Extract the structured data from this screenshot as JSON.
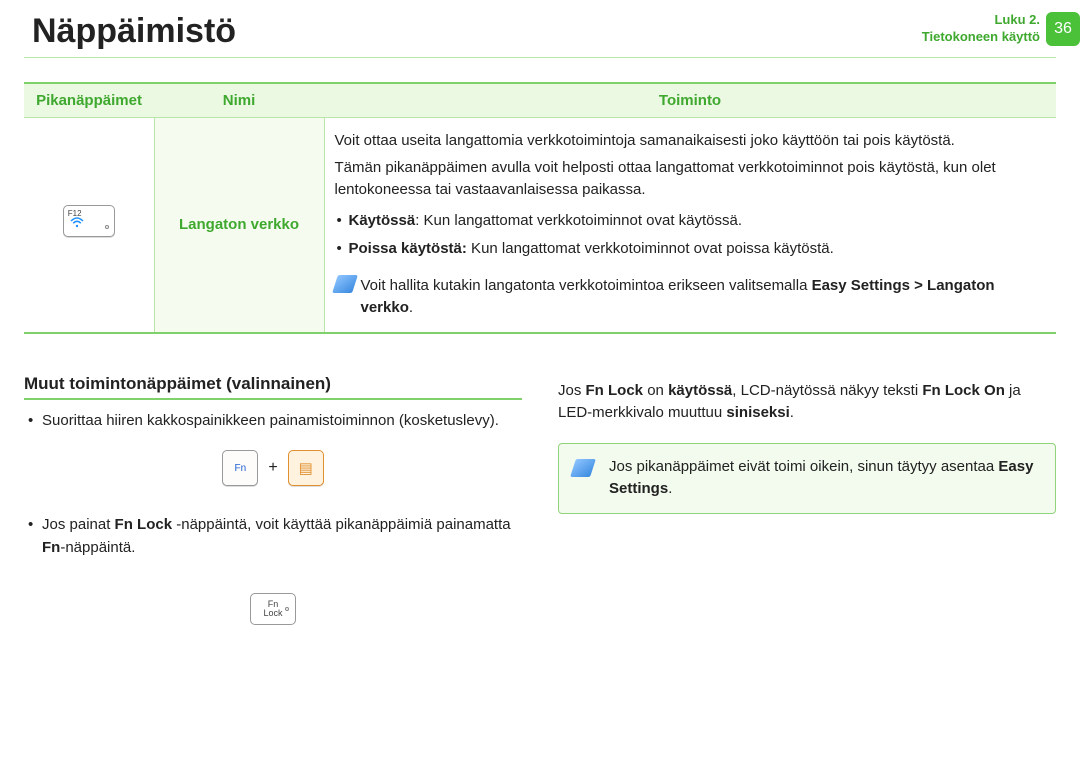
{
  "header": {
    "title": "Näppäimistö",
    "chapter_line1": "Luku 2.",
    "chapter_line2": "Tietokoneen käyttö",
    "page_number": "36"
  },
  "table": {
    "headers": {
      "col1": "Pikanäppäimet",
      "col2": "Nimi",
      "col3": "Toiminto"
    },
    "row": {
      "key_label": "F12",
      "name": "Langaton verkko",
      "func": {
        "p1": "Voit ottaa useita langattomia verkkotoimintoja samanaikaisesti joko käyttöön tai pois käytöstä.",
        "p2": "Tämän pikanäppäimen avulla voit helposti ottaa langattomat verkkotoiminnot pois käytöstä, kun olet lentokoneessa tai vastaavanlaisessa paikassa.",
        "b1_label": "Käytössä",
        "b1_text": ": Kun langattomat verkkotoiminnot ovat käytössä.",
        "b2_label": "Poissa käytöstä:",
        "b2_text": " Kun langattomat verkkotoiminnot ovat poissa käytöstä.",
        "tip_pre": "Voit hallita kutakin langatonta verkkotoimintoa erikseen valitsemalla ",
        "tip_bold1": "Easy Settings > Langaton verkko",
        "tip_post": "."
      }
    }
  },
  "section": {
    "heading": "Muut toimintonäppäimet (valinnainen)",
    "left": {
      "item1": "Suorittaa hiiren kakkospainikkeen painamistoiminnon (kosketuslevy).",
      "fn_label": "Fn",
      "plus": "+",
      "item2_pre": "Jos painat ",
      "item2_b1": "Fn Lock",
      "item2_mid": " -näppäintä, voit käyttää pikanäppäimiä painamatta ",
      "item2_b2": "Fn",
      "item2_post": "-näppäintä.",
      "fnlock_line1": "Fn",
      "fnlock_line2": "Lock"
    },
    "right": {
      "p_pre": "Jos ",
      "p_b1": "Fn Lock",
      "p_mid1": " on ",
      "p_b2": "käytössä",
      "p_mid2": ", LCD-näytössä näkyy teksti ",
      "p_b3": "Fn Lock On",
      "p_mid3": " ja LED-merkkivalo muuttuu ",
      "p_b4": "siniseksi",
      "p_post": ".",
      "info_pre": "Jos pikanäppäimet eivät toimi oikein, sinun täytyy asentaa ",
      "info_bold": "Easy Settings",
      "info_post": "."
    }
  }
}
